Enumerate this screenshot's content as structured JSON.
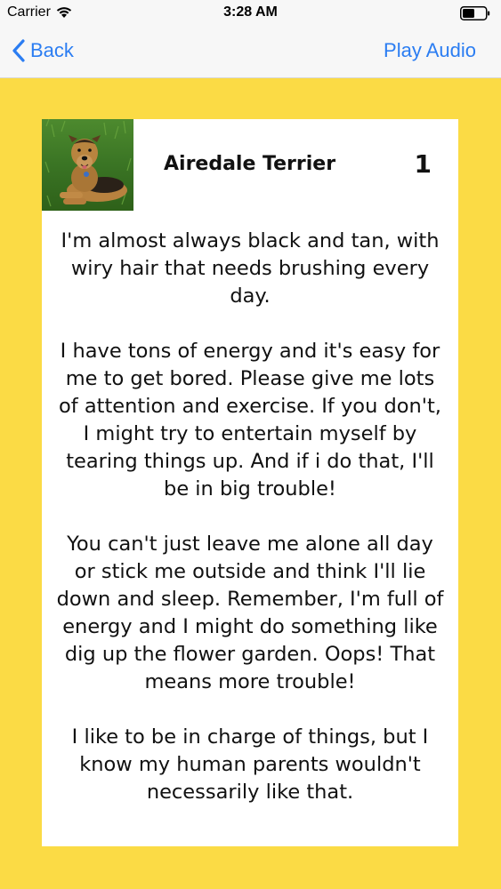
{
  "status_bar": {
    "carrier": "Carrier",
    "time": "3:28 AM"
  },
  "nav": {
    "back_label": "Back",
    "action_label": "Play Audio",
    "tint_color": "#2b7df2"
  },
  "card": {
    "breed": "Airedale Terrier",
    "number": "1",
    "paragraphs": [
      "I'm almost always black and tan, with wiry hair that needs brushing every day.",
      "I have tons of energy and it's easy for me to get bored. Please give me lots of attention and exercise. If you don't, I might try to entertain myself by tearing things up. And if i do that, I'll be in big trouble!",
      "You can't just leave me alone all day or stick me outside and think I'll lie down and sleep. Remember, I'm full of energy and I might do something like dig up the flower garden. Oops! That means more trouble!",
      "I like to be in charge of things, but I know my human parents wouldn't necessarily like that."
    ]
  },
  "colors": {
    "background": "#fbdb45",
    "card": "#ffffff"
  }
}
